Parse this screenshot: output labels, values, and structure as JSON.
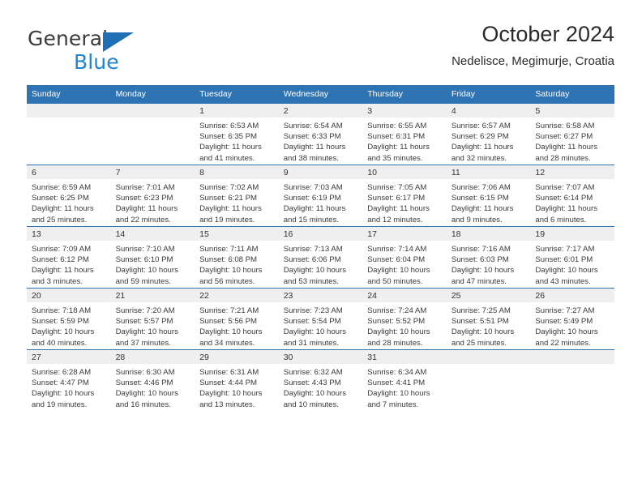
{
  "brand": {
    "name_top": "General",
    "name_bottom": "Blue",
    "accent_color": "#1f84d6",
    "triangle_color": "#1f6fb5"
  },
  "header": {
    "title": "October 2024",
    "subtitle": "Nedelisce, Megimurje, Croatia"
  },
  "theme": {
    "header_row_color": "#2e74b5",
    "daynum_band_color": "#efefef",
    "row_divider_color": "#2e74b5",
    "text_color": "#3a3a3a"
  },
  "weekdays": [
    "Sunday",
    "Monday",
    "Tuesday",
    "Wednesday",
    "Thursday",
    "Friday",
    "Saturday"
  ],
  "labels": {
    "sunrise_prefix": "Sunrise:",
    "sunset_prefix": "Sunset:",
    "daylight_prefix": "Daylight:"
  },
  "weeks": [
    [
      {
        "day": "",
        "empty": true
      },
      {
        "day": "",
        "empty": true
      },
      {
        "day": "1",
        "sunrise": "Sunrise: 6:53 AM",
        "sunset": "Sunset: 6:35 PM",
        "daylight_line1": "Daylight: 11 hours",
        "daylight_line2": "and 41 minutes."
      },
      {
        "day": "2",
        "sunrise": "Sunrise: 6:54 AM",
        "sunset": "Sunset: 6:33 PM",
        "daylight_line1": "Daylight: 11 hours",
        "daylight_line2": "and 38 minutes."
      },
      {
        "day": "3",
        "sunrise": "Sunrise: 6:55 AM",
        "sunset": "Sunset: 6:31 PM",
        "daylight_line1": "Daylight: 11 hours",
        "daylight_line2": "and 35 minutes."
      },
      {
        "day": "4",
        "sunrise": "Sunrise: 6:57 AM",
        "sunset": "Sunset: 6:29 PM",
        "daylight_line1": "Daylight: 11 hours",
        "daylight_line2": "and 32 minutes."
      },
      {
        "day": "5",
        "sunrise": "Sunrise: 6:58 AM",
        "sunset": "Sunset: 6:27 PM",
        "daylight_line1": "Daylight: 11 hours",
        "daylight_line2": "and 28 minutes."
      }
    ],
    [
      {
        "day": "6",
        "sunrise": "Sunrise: 6:59 AM",
        "sunset": "Sunset: 6:25 PM",
        "daylight_line1": "Daylight: 11 hours",
        "daylight_line2": "and 25 minutes."
      },
      {
        "day": "7",
        "sunrise": "Sunrise: 7:01 AM",
        "sunset": "Sunset: 6:23 PM",
        "daylight_line1": "Daylight: 11 hours",
        "daylight_line2": "and 22 minutes."
      },
      {
        "day": "8",
        "sunrise": "Sunrise: 7:02 AM",
        "sunset": "Sunset: 6:21 PM",
        "daylight_line1": "Daylight: 11 hours",
        "daylight_line2": "and 19 minutes."
      },
      {
        "day": "9",
        "sunrise": "Sunrise: 7:03 AM",
        "sunset": "Sunset: 6:19 PM",
        "daylight_line1": "Daylight: 11 hours",
        "daylight_line2": "and 15 minutes."
      },
      {
        "day": "10",
        "sunrise": "Sunrise: 7:05 AM",
        "sunset": "Sunset: 6:17 PM",
        "daylight_line1": "Daylight: 11 hours",
        "daylight_line2": "and 12 minutes."
      },
      {
        "day": "11",
        "sunrise": "Sunrise: 7:06 AM",
        "sunset": "Sunset: 6:15 PM",
        "daylight_line1": "Daylight: 11 hours",
        "daylight_line2": "and 9 minutes."
      },
      {
        "day": "12",
        "sunrise": "Sunrise: 7:07 AM",
        "sunset": "Sunset: 6:14 PM",
        "daylight_line1": "Daylight: 11 hours",
        "daylight_line2": "and 6 minutes."
      }
    ],
    [
      {
        "day": "13",
        "sunrise": "Sunrise: 7:09 AM",
        "sunset": "Sunset: 6:12 PM",
        "daylight_line1": "Daylight: 11 hours",
        "daylight_line2": "and 3 minutes."
      },
      {
        "day": "14",
        "sunrise": "Sunrise: 7:10 AM",
        "sunset": "Sunset: 6:10 PM",
        "daylight_line1": "Daylight: 10 hours",
        "daylight_line2": "and 59 minutes."
      },
      {
        "day": "15",
        "sunrise": "Sunrise: 7:11 AM",
        "sunset": "Sunset: 6:08 PM",
        "daylight_line1": "Daylight: 10 hours",
        "daylight_line2": "and 56 minutes."
      },
      {
        "day": "16",
        "sunrise": "Sunrise: 7:13 AM",
        "sunset": "Sunset: 6:06 PM",
        "daylight_line1": "Daylight: 10 hours",
        "daylight_line2": "and 53 minutes."
      },
      {
        "day": "17",
        "sunrise": "Sunrise: 7:14 AM",
        "sunset": "Sunset: 6:04 PM",
        "daylight_line1": "Daylight: 10 hours",
        "daylight_line2": "and 50 minutes."
      },
      {
        "day": "18",
        "sunrise": "Sunrise: 7:16 AM",
        "sunset": "Sunset: 6:03 PM",
        "daylight_line1": "Daylight: 10 hours",
        "daylight_line2": "and 47 minutes."
      },
      {
        "day": "19",
        "sunrise": "Sunrise: 7:17 AM",
        "sunset": "Sunset: 6:01 PM",
        "daylight_line1": "Daylight: 10 hours",
        "daylight_line2": "and 43 minutes."
      }
    ],
    [
      {
        "day": "20",
        "sunrise": "Sunrise: 7:18 AM",
        "sunset": "Sunset: 5:59 PM",
        "daylight_line1": "Daylight: 10 hours",
        "daylight_line2": "and 40 minutes."
      },
      {
        "day": "21",
        "sunrise": "Sunrise: 7:20 AM",
        "sunset": "Sunset: 5:57 PM",
        "daylight_line1": "Daylight: 10 hours",
        "daylight_line2": "and 37 minutes."
      },
      {
        "day": "22",
        "sunrise": "Sunrise: 7:21 AM",
        "sunset": "Sunset: 5:56 PM",
        "daylight_line1": "Daylight: 10 hours",
        "daylight_line2": "and 34 minutes."
      },
      {
        "day": "23",
        "sunrise": "Sunrise: 7:23 AM",
        "sunset": "Sunset: 5:54 PM",
        "daylight_line1": "Daylight: 10 hours",
        "daylight_line2": "and 31 minutes."
      },
      {
        "day": "24",
        "sunrise": "Sunrise: 7:24 AM",
        "sunset": "Sunset: 5:52 PM",
        "daylight_line1": "Daylight: 10 hours",
        "daylight_line2": "and 28 minutes."
      },
      {
        "day": "25",
        "sunrise": "Sunrise: 7:25 AM",
        "sunset": "Sunset: 5:51 PM",
        "daylight_line1": "Daylight: 10 hours",
        "daylight_line2": "and 25 minutes."
      },
      {
        "day": "26",
        "sunrise": "Sunrise: 7:27 AM",
        "sunset": "Sunset: 5:49 PM",
        "daylight_line1": "Daylight: 10 hours",
        "daylight_line2": "and 22 minutes."
      }
    ],
    [
      {
        "day": "27",
        "sunrise": "Sunrise: 6:28 AM",
        "sunset": "Sunset: 4:47 PM",
        "daylight_line1": "Daylight: 10 hours",
        "daylight_line2": "and 19 minutes."
      },
      {
        "day": "28",
        "sunrise": "Sunrise: 6:30 AM",
        "sunset": "Sunset: 4:46 PM",
        "daylight_line1": "Daylight: 10 hours",
        "daylight_line2": "and 16 minutes."
      },
      {
        "day": "29",
        "sunrise": "Sunrise: 6:31 AM",
        "sunset": "Sunset: 4:44 PM",
        "daylight_line1": "Daylight: 10 hours",
        "daylight_line2": "and 13 minutes."
      },
      {
        "day": "30",
        "sunrise": "Sunrise: 6:32 AM",
        "sunset": "Sunset: 4:43 PM",
        "daylight_line1": "Daylight: 10 hours",
        "daylight_line2": "and 10 minutes."
      },
      {
        "day": "31",
        "sunrise": "Sunrise: 6:34 AM",
        "sunset": "Sunset: 4:41 PM",
        "daylight_line1": "Daylight: 10 hours",
        "daylight_line2": "and 7 minutes."
      },
      {
        "day": "",
        "empty": true
      },
      {
        "day": "",
        "empty": true
      }
    ]
  ]
}
